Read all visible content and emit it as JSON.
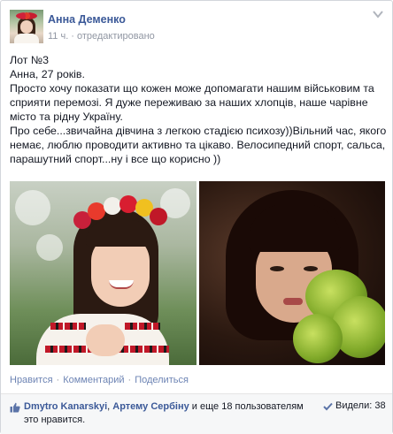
{
  "post": {
    "author": "Анна Деменко",
    "time": "11 ч.",
    "separator": "·",
    "edited": "отредактировано",
    "text_lines": [
      "Лот №3",
      "Анна, 27 років.",
      "Просто хочу показати що кожен може допомагати нашим військовим та сприяти перемозі. Я дуже переживаю за наших хлопців, наше чарівне місто та рідну Україну.",
      "Про себе...звичайна дівчина з легкою стадією психозу))Вільний час, якого немає, люблю проводити активно та цікаво. Велосипедний спорт, сальса, парашутний спорт...ну і все що корисно ))"
    ]
  },
  "actions": {
    "like": "Нравится",
    "comment": "Комментарий",
    "share": "Поделиться",
    "separator": "·"
  },
  "footer": {
    "liker1": "Dmytro Kanarskyi",
    "comma": ",",
    "liker2": "Артему Сербіну",
    "and_others": "и еще 18 пользователям",
    "suffix": "это нравится.",
    "seen": "Видели: 38"
  },
  "icons": {
    "avatar": "avatar-photo",
    "chevron": "chevron-down-icon",
    "like": "thumbs-up-icon",
    "seen": "checkmark-icon"
  },
  "colors": {
    "link": "#3b5998",
    "meta": "#9197a3",
    "action_link": "#6d84b4",
    "footer_bg": "#f6f7f8"
  }
}
